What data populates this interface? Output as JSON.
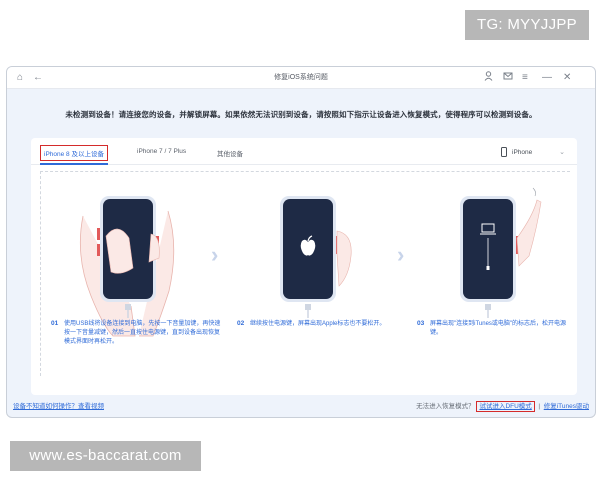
{
  "watermarks": {
    "top": "TG: MYYJJPP",
    "bottom": "www.es-baccarat.com"
  },
  "window": {
    "title": "修复iOS系统问题",
    "nav": {
      "home_icon": "home-icon",
      "back_icon": "back-arrow-icon"
    },
    "controls": [
      "user-icon",
      "mail-icon",
      "menu-icon",
      "minimize-icon",
      "close-icon"
    ]
  },
  "notice": "未检测到设备！请连接您的设备，并解锁屏幕。如果依然无法识别到设备，请按照如下指示让设备进入恢复模式，使得程序可以检测到设备。",
  "tabs": [
    {
      "label": "iPhone 8 及以上设备",
      "active": true
    },
    {
      "label": "iPhone 7 / 7 Plus",
      "active": false
    },
    {
      "label": "其他设备",
      "active": false
    }
  ],
  "device_select": {
    "value": "iPhone"
  },
  "steps": [
    {
      "num": "01",
      "text": "使用USB线将设备连接到电脑，先按一下音量加键，再快速按一下音量减键，然后一直按住电源键，直到设备出现恢复模式界面时再松开。"
    },
    {
      "num": "02",
      "text": "继续按住电源键，屏幕出现Apple标志也不要松开。"
    },
    {
      "num": "03",
      "text": "屏幕出现\"连接到iTunes或电脑\"的标志后，松开电源键。"
    }
  ],
  "footer": {
    "left_link": "设备不知道如何操作？查看视频",
    "right_prefix": "无法进入恢复模式？",
    "dfu_link": "试试进入DFU模式",
    "itunes_link": "修复iTunes驱动"
  },
  "colors": {
    "accent": "#2f6bd8",
    "highlight": "#d42b2b",
    "screen": "#1e2a45",
    "bg": "#eef3fb"
  }
}
